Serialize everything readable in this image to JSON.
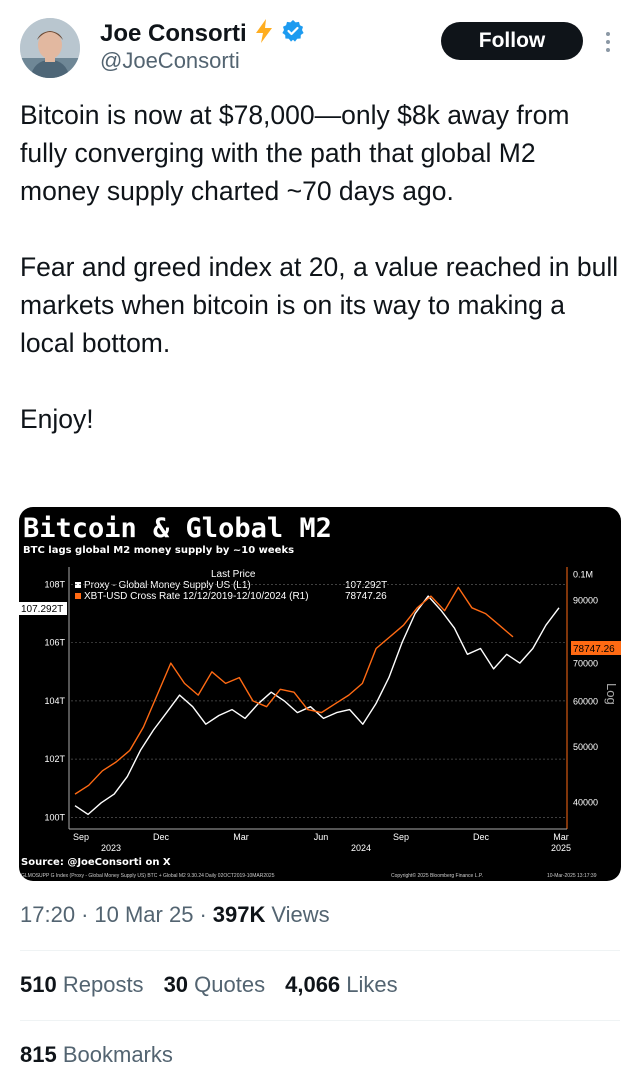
{
  "author": {
    "name": "Joe Consorti",
    "handle": "@JoeConsorti",
    "follow_label": "Follow"
  },
  "tweet": {
    "text": "Bitcoin is now at $78,000—only $8k away from fully converging with the path that global M2 money supply charted ~70 days ago.\n\nFear and greed index at 20, a value reached in bull markets when bitcoin is on its way to making a local bottom.\n\nEnjoy!"
  },
  "chart_data": {
    "type": "line",
    "title": "Bitcoin & Global M2",
    "subtitle": "BTC lags global M2 money supply by ~10 weeks",
    "legend_header": "Last Price",
    "legend": [
      {
        "label": "Proxy - Global Money Supply US  (L1)",
        "value": "107.292T",
        "color": "#ffffff"
      },
      {
        "label": "XBT-USD Cross Rate 12/12/2019-12/10/2024  (R1)",
        "value": "78747.26",
        "color": "#ff6a13"
      }
    ],
    "y_left_ticks": [
      "108T",
      "106T",
      "104T",
      "102T",
      "100T"
    ],
    "y_left_ticks_values": [
      108,
      106,
      104,
      102,
      100
    ],
    "y_left_badge": "107.292T",
    "y_right_ticks": [
      "0.1M",
      "90000",
      "70000",
      "60000",
      "50000",
      "40000"
    ],
    "y_right_ticks_values": [
      100000,
      90000,
      70000,
      60000,
      50000,
      40000
    ],
    "y_right_badge": "78747.26",
    "log_label": "Log",
    "x_ticks": [
      "Sep",
      "Dec",
      "Mar",
      "Jun",
      "Sep",
      "Dec",
      "Mar"
    ],
    "x_years": [
      "2023",
      "2024",
      "2025"
    ],
    "source": "Source: @JoeConsorti on X",
    "footer_left": "GLMOSUPP G Index (Proxy - Global Money Supply US) BTC + Global M2 9.30.24  Daily 02OCT2019-10MAR2025",
    "footer_mid": "Copyright© 2025 Bloomberg Finance L.P.",
    "footer_right": "10-Mar-2025 13:17:39",
    "series": [
      {
        "name": "Proxy - Global Money Supply US",
        "color": "#ffffff",
        "values": [
          100.4,
          100.1,
          100.5,
          100.8,
          101.4,
          102.3,
          103.0,
          103.6,
          104.2,
          103.8,
          103.2,
          103.5,
          103.7,
          103.4,
          103.9,
          104.3,
          104.0,
          103.6,
          103.8,
          103.4,
          103.6,
          103.7,
          103.2,
          103.9,
          104.8,
          106.0,
          107.0,
          107.6,
          107.1,
          106.5,
          105.6,
          105.8,
          105.1,
          105.6,
          105.3,
          105.8,
          106.6,
          107.2
        ]
      },
      {
        "name": "XBT-USD Cross Rate",
        "color": "#ff6a13",
        "values": [
          100.8,
          101.1,
          101.6,
          101.9,
          102.3,
          103.1,
          104.2,
          105.3,
          104.6,
          104.2,
          105.0,
          104.6,
          104.8,
          104.0,
          103.8,
          104.4,
          104.3,
          103.7,
          103.6,
          103.9,
          104.2,
          104.6,
          105.8,
          106.2,
          106.6,
          107.2,
          107.6,
          107.1,
          107.9,
          107.2,
          107.0,
          106.6,
          106.2
        ]
      }
    ]
  },
  "meta": {
    "time": "17:20",
    "sep": "·",
    "date": "10 Mar 25",
    "views_count": "397K",
    "views_label": "Views"
  },
  "stats": {
    "reposts_count": "510",
    "reposts_label": "Reposts",
    "quotes_count": "30",
    "quotes_label": "Quotes",
    "likes_count": "4,066",
    "likes_label": "Likes",
    "bookmarks_count": "815",
    "bookmarks_label": "Bookmarks"
  },
  "colors": {
    "follow_bg": "#0f1419",
    "verified": "#1d9bf0",
    "lightning": "#ffad1f",
    "secondary_text": "#536471",
    "chart_orange": "#ff6a13"
  }
}
